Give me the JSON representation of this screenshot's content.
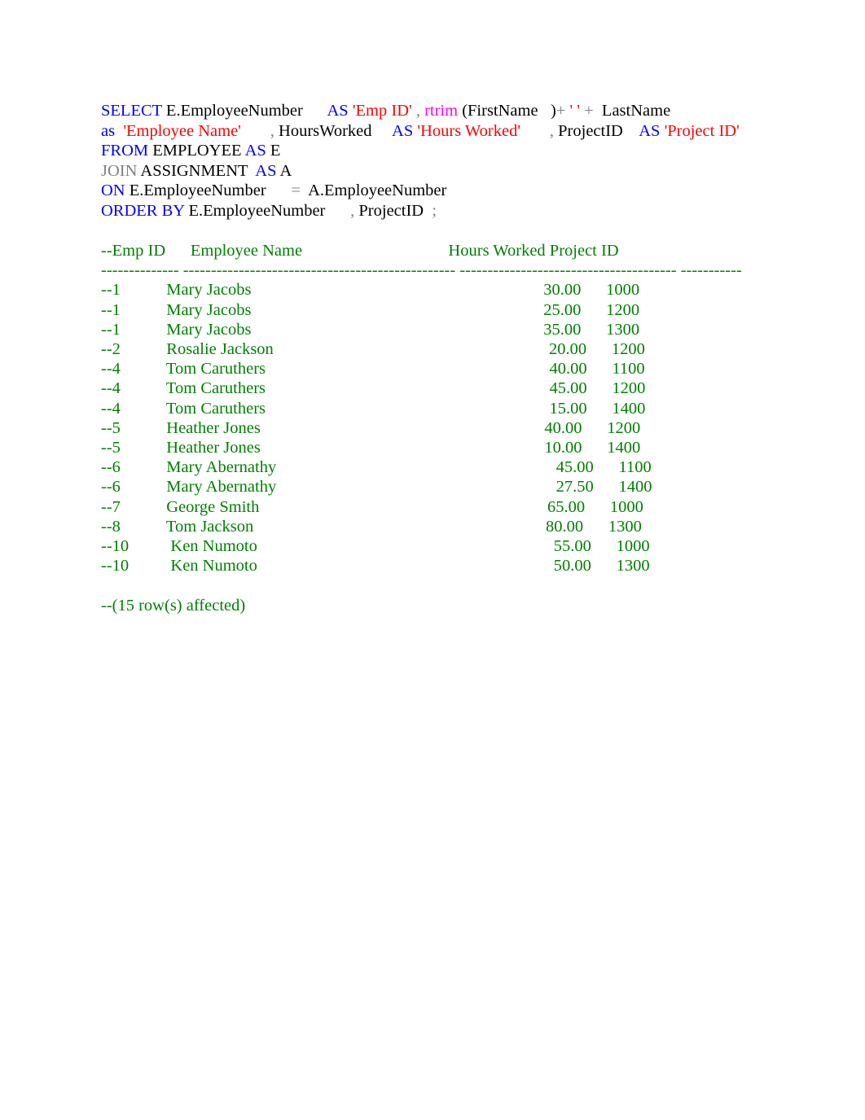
{
  "document": {
    "kind": "sql-script-with-commented-output",
    "text_color_plain": "#000000",
    "color_keyword": "#0000ff",
    "color_keyword_gray": "#808080",
    "color_string": "#ff0000",
    "color_function": "#ff00ff",
    "color_operator": "#808080",
    "color_output_comment": "#008000",
    "page_background": "#ffffff"
  },
  "query": {
    "line1": {
      "select": "SELECT",
      "col1": " E.EmployeeNumber      ",
      "as1": "AS",
      "alias1": " 'Emp ID' ",
      "comma1": ",",
      "rtrim": " rtrim ",
      "open_paren": "(FirstName   ",
      "close_paren": ")",
      "plus1": "+",
      "space_literal": " ' ' ",
      "plus2": "+",
      "lastname": "  LastName"
    },
    "line2": {
      "as2": "as",
      "alias2": "  'Employee Name'",
      "comma2": "       ,",
      "col3": " HoursWorked     ",
      "as3": "AS",
      "alias3": " 'Hours Worked' ",
      "comma3": "      ,",
      "col4": " ProjectID    ",
      "as4": "AS",
      "alias4": " 'Project ID'"
    },
    "line3": {
      "from": "FROM",
      "table": " EMPLOYEE ",
      "as": "AS",
      "alias": " E"
    },
    "line4": {
      "join": "JOIN",
      "table": " ASSIGNMENT  ",
      "as": "AS",
      "alias": " A"
    },
    "line5": {
      "on": "ON",
      "left": " E.EmployeeNumber      ",
      "eq": "=",
      "right": "  A.EmployeeNumber"
    },
    "line6": {
      "order_by": "ORDER BY",
      "col1": " E.EmployeeNumber      ",
      "comma": ",",
      "col2": " ProjectID  ",
      "semicolon": ";"
    }
  },
  "result_output": {
    "header": "--Emp ID      Employee Name                                   Hours Worked Project ID",
    "separator": "-------------- ------------------------------------------------- --------------------------------------- -----------",
    "footer": "--(15 row(s) affected)",
    "columns": [
      "Emp ID",
      "Employee Name",
      "Hours Worked",
      "Project ID"
    ],
    "row_count_label": "15 row(s) affected",
    "rows": [
      {
        "emp_id": "--1",
        "name": "Mary Jacobs",
        "hours": "30.00",
        "project_id": "1000"
      },
      {
        "emp_id": "--1",
        "name": "Mary Jacobs",
        "hours": "25.00",
        "project_id": "1200"
      },
      {
        "emp_id": "--1",
        "name": "Mary Jacobs",
        "hours": "35.00",
        "project_id": "1300"
      },
      {
        "emp_id": "--2",
        "name": "Rosalie Jackson",
        "hours": "20.00",
        "project_id": "1200"
      },
      {
        "emp_id": "--4",
        "name": "Tom Caruthers",
        "hours": "40.00",
        "project_id": "1100"
      },
      {
        "emp_id": "--4",
        "name": "Tom Caruthers",
        "hours": "45.00",
        "project_id": "1200"
      },
      {
        "emp_id": "--4",
        "name": "Tom Caruthers",
        "hours": "15.00",
        "project_id": "1400"
      },
      {
        "emp_id": "--5",
        "name": "Heather Jones",
        "hours": "40.00",
        "project_id": "1200"
      },
      {
        "emp_id": "--5",
        "name": "Heather Jones",
        "hours": "10.00",
        "project_id": "1400"
      },
      {
        "emp_id": "--6",
        "name": "Mary Abernathy",
        "hours": "45.00",
        "project_id": "1100"
      },
      {
        "emp_id": "--6",
        "name": "Mary Abernathy",
        "hours": "27.50",
        "project_id": "1400"
      },
      {
        "emp_id": "--7",
        "name": "George Smith",
        "hours": "65.00",
        "project_id": "1000"
      },
      {
        "emp_id": "--8",
        "name": "Tom Jackson",
        "hours": "80.00",
        "project_id": "1300"
      },
      {
        "emp_id": "--10",
        "name": "Ken Numoto",
        "hours": "55.00",
        "project_id": "1000"
      },
      {
        "emp_id": "--10",
        "name": "Ken Numoto",
        "hours": "50.00",
        "project_id": "1300"
      }
    ]
  }
}
